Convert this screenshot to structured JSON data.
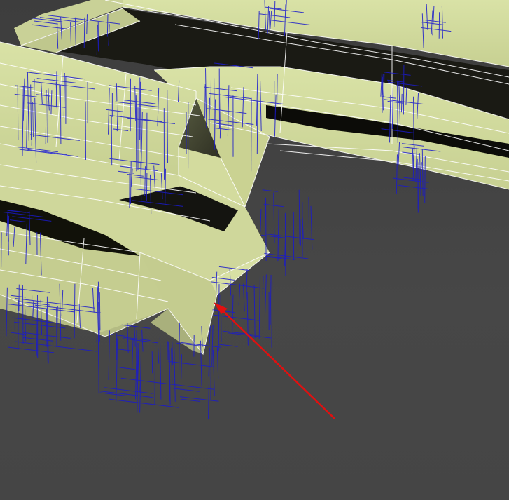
{
  "viewport": {
    "background_color": "#444444",
    "mesh_face_color": "#d6dfa1",
    "mesh_shade_color": "#a9b07c",
    "wire_color": "#1a1acc",
    "edge_color": "#ffffff",
    "annotation_color": "#e01010"
  },
  "annotation": {
    "type": "arrow",
    "icon": "red-arrow-icon"
  }
}
